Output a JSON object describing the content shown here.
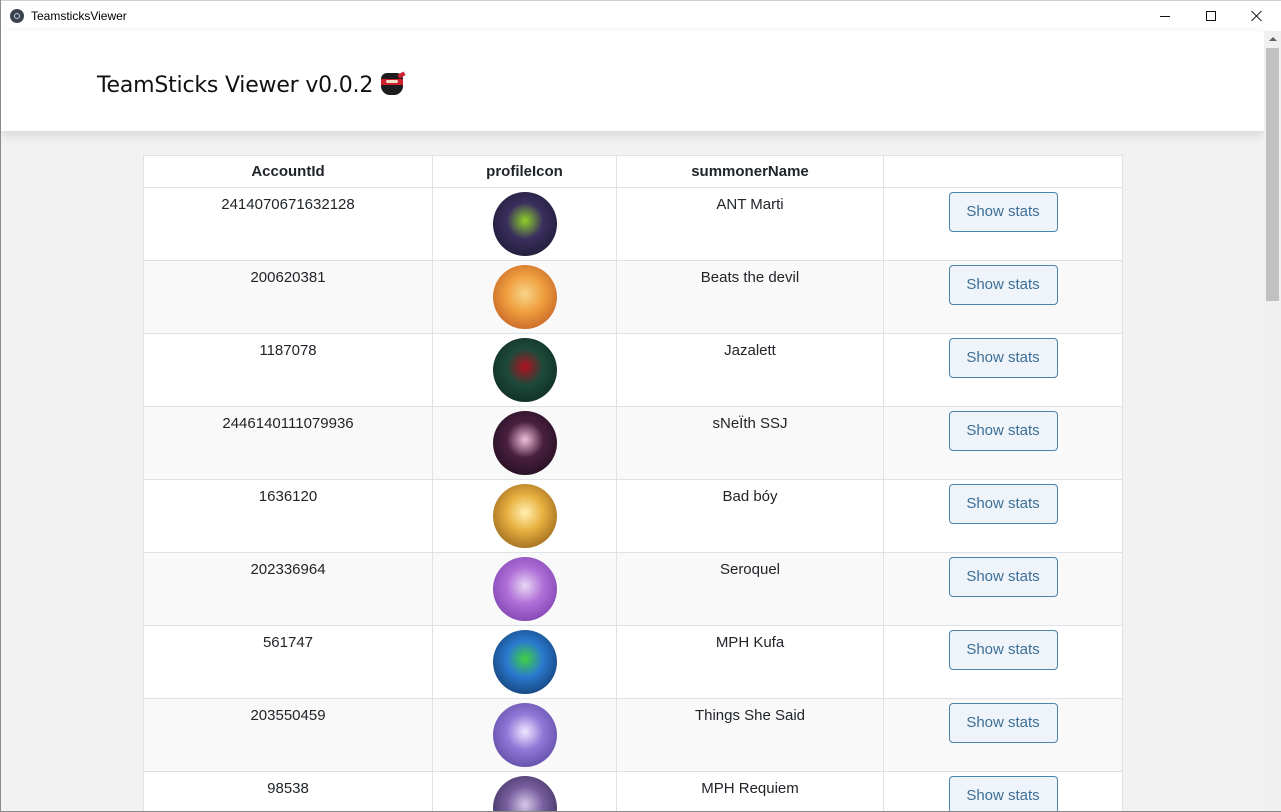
{
  "window": {
    "title": "TeamsticksViewer"
  },
  "header": {
    "title": "TeamSticks Viewer v0.0.2"
  },
  "table": {
    "columns": [
      "AccountId",
      "profileIcon",
      "summonerName",
      ""
    ],
    "rows": [
      {
        "account_id": "2414070671632128",
        "summoner_name": "ANT Marti",
        "button": "Show stats",
        "icon": "hooded-figure-icon",
        "icon_colors": [
          "#3a2f5e",
          "#151426",
          "#8fd12a"
        ]
      },
      {
        "account_id": "200620381",
        "summoner_name": "Beats the devil",
        "button": "Show stats",
        "icon": "golden-warrior-icon",
        "icon_colors": [
          "#f0a040",
          "#b34c1c",
          "#f6d58a"
        ]
      },
      {
        "account_id": "1187078",
        "summoner_name": "Jazalett",
        "button": "Show stats",
        "icon": "rose-icon",
        "icon_colors": [
          "#1d4a3a",
          "#0c2219",
          "#b01022"
        ]
      },
      {
        "account_id": "2446140111079936",
        "summoner_name": "sNeÏth SSJ",
        "button": "Show stats",
        "icon": "emblem-icon",
        "icon_colors": [
          "#4a2040",
          "#120812",
          "#f0c0d8"
        ]
      },
      {
        "account_id": "1636120",
        "summoner_name": "Bad bóy",
        "button": "Show stats",
        "icon": "gold-helmet-icon",
        "icon_colors": [
          "#e8b040",
          "#7a4a10",
          "#fff0b0"
        ]
      },
      {
        "account_id": "202336964",
        "summoner_name": "Seroquel",
        "button": "Show stats",
        "icon": "elf-girl-icon",
        "icon_colors": [
          "#b070d8",
          "#6a2fa0",
          "#e8d8f4"
        ]
      },
      {
        "account_id": "561747",
        "summoner_name": "MPH Kufa",
        "button": "Show stats",
        "icon": "potion-icon",
        "icon_colors": [
          "#2a7ad0",
          "#0c2850",
          "#40d040"
        ]
      },
      {
        "account_id": "203550459",
        "summoner_name": "Things She Said",
        "button": "Show stats",
        "icon": "star-guardian-icon",
        "icon_colors": [
          "#9078d8",
          "#4a3a90",
          "#f0e8ff"
        ]
      },
      {
        "account_id": "98538",
        "summoner_name": "MPH Requiem",
        "button": "Show stats",
        "icon": "dragon-icon",
        "icon_colors": [
          "#7860a0",
          "#2a1a40",
          "#d8c8e8"
        ]
      }
    ]
  }
}
